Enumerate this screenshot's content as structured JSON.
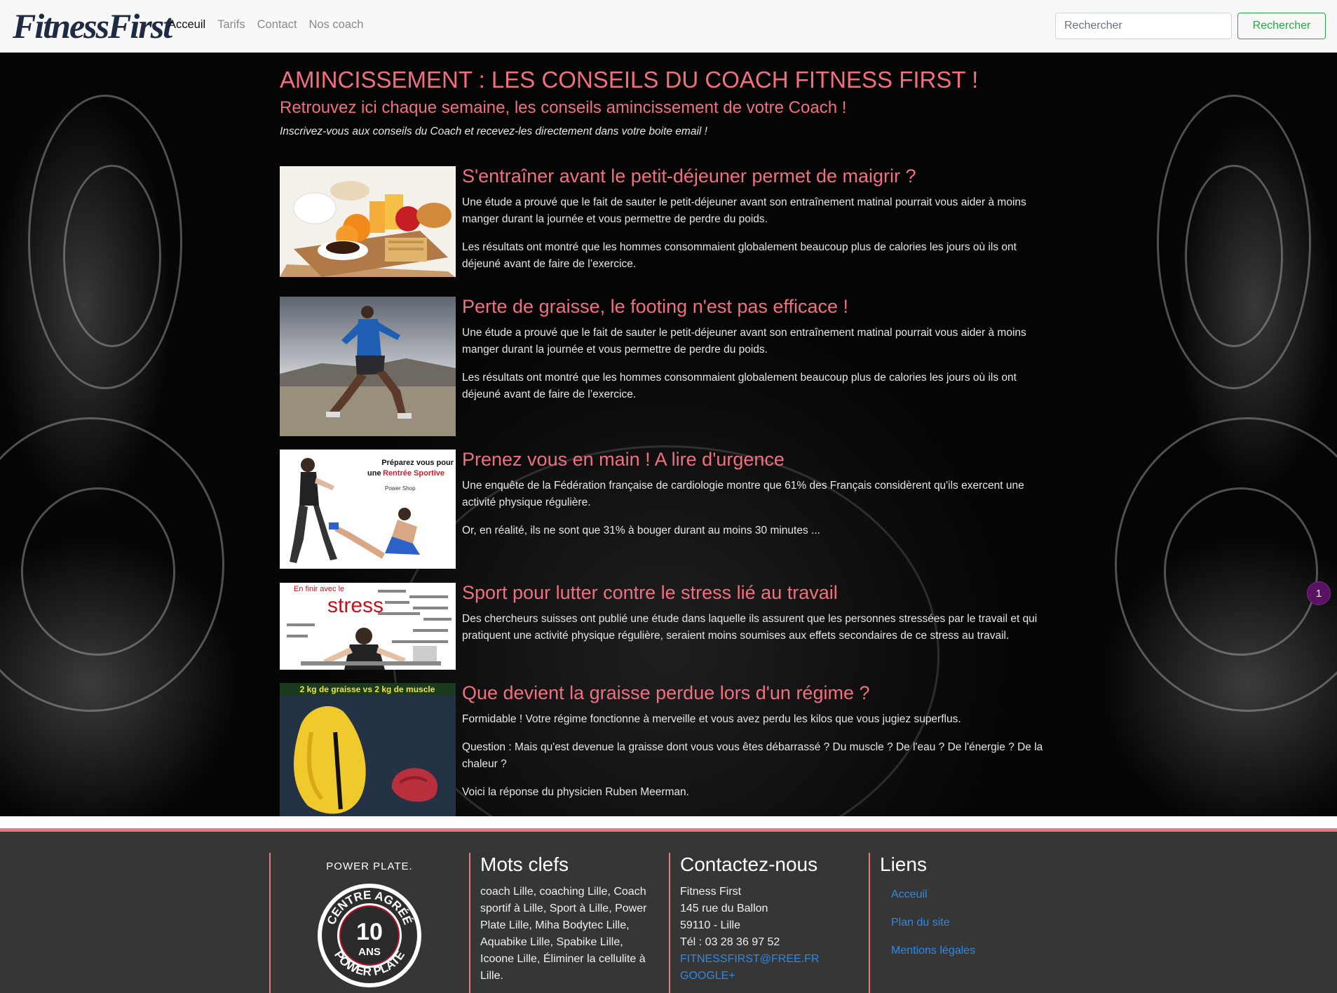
{
  "navbar": {
    "brand": "FitnessFirst",
    "links": [
      "Acceuil",
      "Tarifs",
      "Contact",
      "Nos coach"
    ],
    "search_placeholder": "Rechercher",
    "search_button": "Rechercher"
  },
  "header": {
    "title": "AMINCISSEMENT : LES CONSEILS DU COACH FITNESS FIRST !",
    "subtitle": "Retrouvez ici chaque semaine, les conseils amincissement de votre Coach !",
    "intro": "Inscrivez-vous aux conseils du Coach et recevez-les directement dans votre boite email !"
  },
  "articles": [
    {
      "title": "S'entraîner avant le petit-déjeuner permet de maigrir ?",
      "paragraphs": [
        "Une étude a prouvé que le fait de sauter le petit-déjeuner avant son entraînement matinal pourrait vous aider à moins manger durant la journée et vous permettre de perdre du poids.",
        "Les résultats ont montré que les hommes consommaient globalement beaucoup plus de calories les jours où ils ont déjeuné avant de faire de l’exercice."
      ]
    },
    {
      "title": "Perte de graisse, le footing n'est pas efficace !",
      "paragraphs": [
        "Une étude a prouvé que le fait de sauter le petit-déjeuner avant son entraînement matinal pourrait vous aider à moins manger durant la journée et vous permettre de perdre du poids.",
        "Les résultats ont montré que les hommes consommaient globalement beaucoup plus de calories les jours où ils ont déjeuné avant de faire de l’exercice."
      ]
    },
    {
      "title": "Prenez vous en main ! A lire d'urgence",
      "image_text_1": "Préparez vous pour",
      "image_text_2": "une",
      "image_text_3": "Rentrée Sportive",
      "image_text_4": "Power Shop",
      "paragraphs": [
        "Une enquête de la Fédération française de cardiologie montre que 61% des Français considèrent qu'ils exercent une activité physique régulière.",
        "Or, en réalité, ils ne sont que 31% à bouger durant au moins 30 minutes ..."
      ]
    },
    {
      "title": "Sport pour lutter contre le stress lié au travail",
      "image_text_1": "En finir avec le",
      "image_text_2": "stress",
      "paragraphs": [
        "Des chercheurs suisses ont publié une étude dans laquelle ils assurent que les personnes stressées par le travail et qui pratiquent une activité physique régulière, seraient moins soumises aux effets secondaires de ce stress au travail."
      ]
    },
    {
      "title": "Que devient la graisse perdue lors d'un régime ?",
      "image_text_1": "2 kg de graisse vs 2 kg de muscle",
      "paragraphs": [
        "Formidable ! Votre régime fonctionne à merveille et vous avez perdu les kilos que vous jugiez superflus.",
        "Question : Mais qu'est devenue la graisse dont vous vous êtes débarrassé ? Du muscle ? De l'eau ? De l'énergie ? De la chaleur ?",
        "Voici la réponse du physicien Ruben Meerman."
      ]
    }
  ],
  "badge": "1",
  "footer": {
    "logo": {
      "top": "POWER PLATE.",
      "ring_top": "CENTRE AGRÉÉ",
      "number": "10",
      "ans": "ANS",
      "ring_bottom": "POWER PLATE"
    },
    "keywords": {
      "title": "Mots clefs",
      "text": "coach Lille, coaching Lille, Coach sportif à Lille, Sport à Lille, Power Plate Lille, Miha Bodytec Lille, Aquabike Lille, Spabike Lille, Icoone Lille, Éliminer la cellulite à Lille."
    },
    "contact": {
      "title": "Contactez-nous",
      "lines": [
        "Fitness First",
        "145 rue du Ballon",
        "59110 - Lille",
        "Tél : 03 28 36 97 52"
      ],
      "email": "FITNESSFIRST@FREE.FR",
      "google": "GOOGLE+"
    },
    "links": {
      "title": "Liens",
      "items": [
        "Acceuil",
        "Plan du site",
        "Mentions légales"
      ]
    }
  },
  "colors": {
    "accent": "#f0707f",
    "link": "#2c8ae6",
    "footer_bg": "#363636",
    "search_green": "#28a745"
  }
}
